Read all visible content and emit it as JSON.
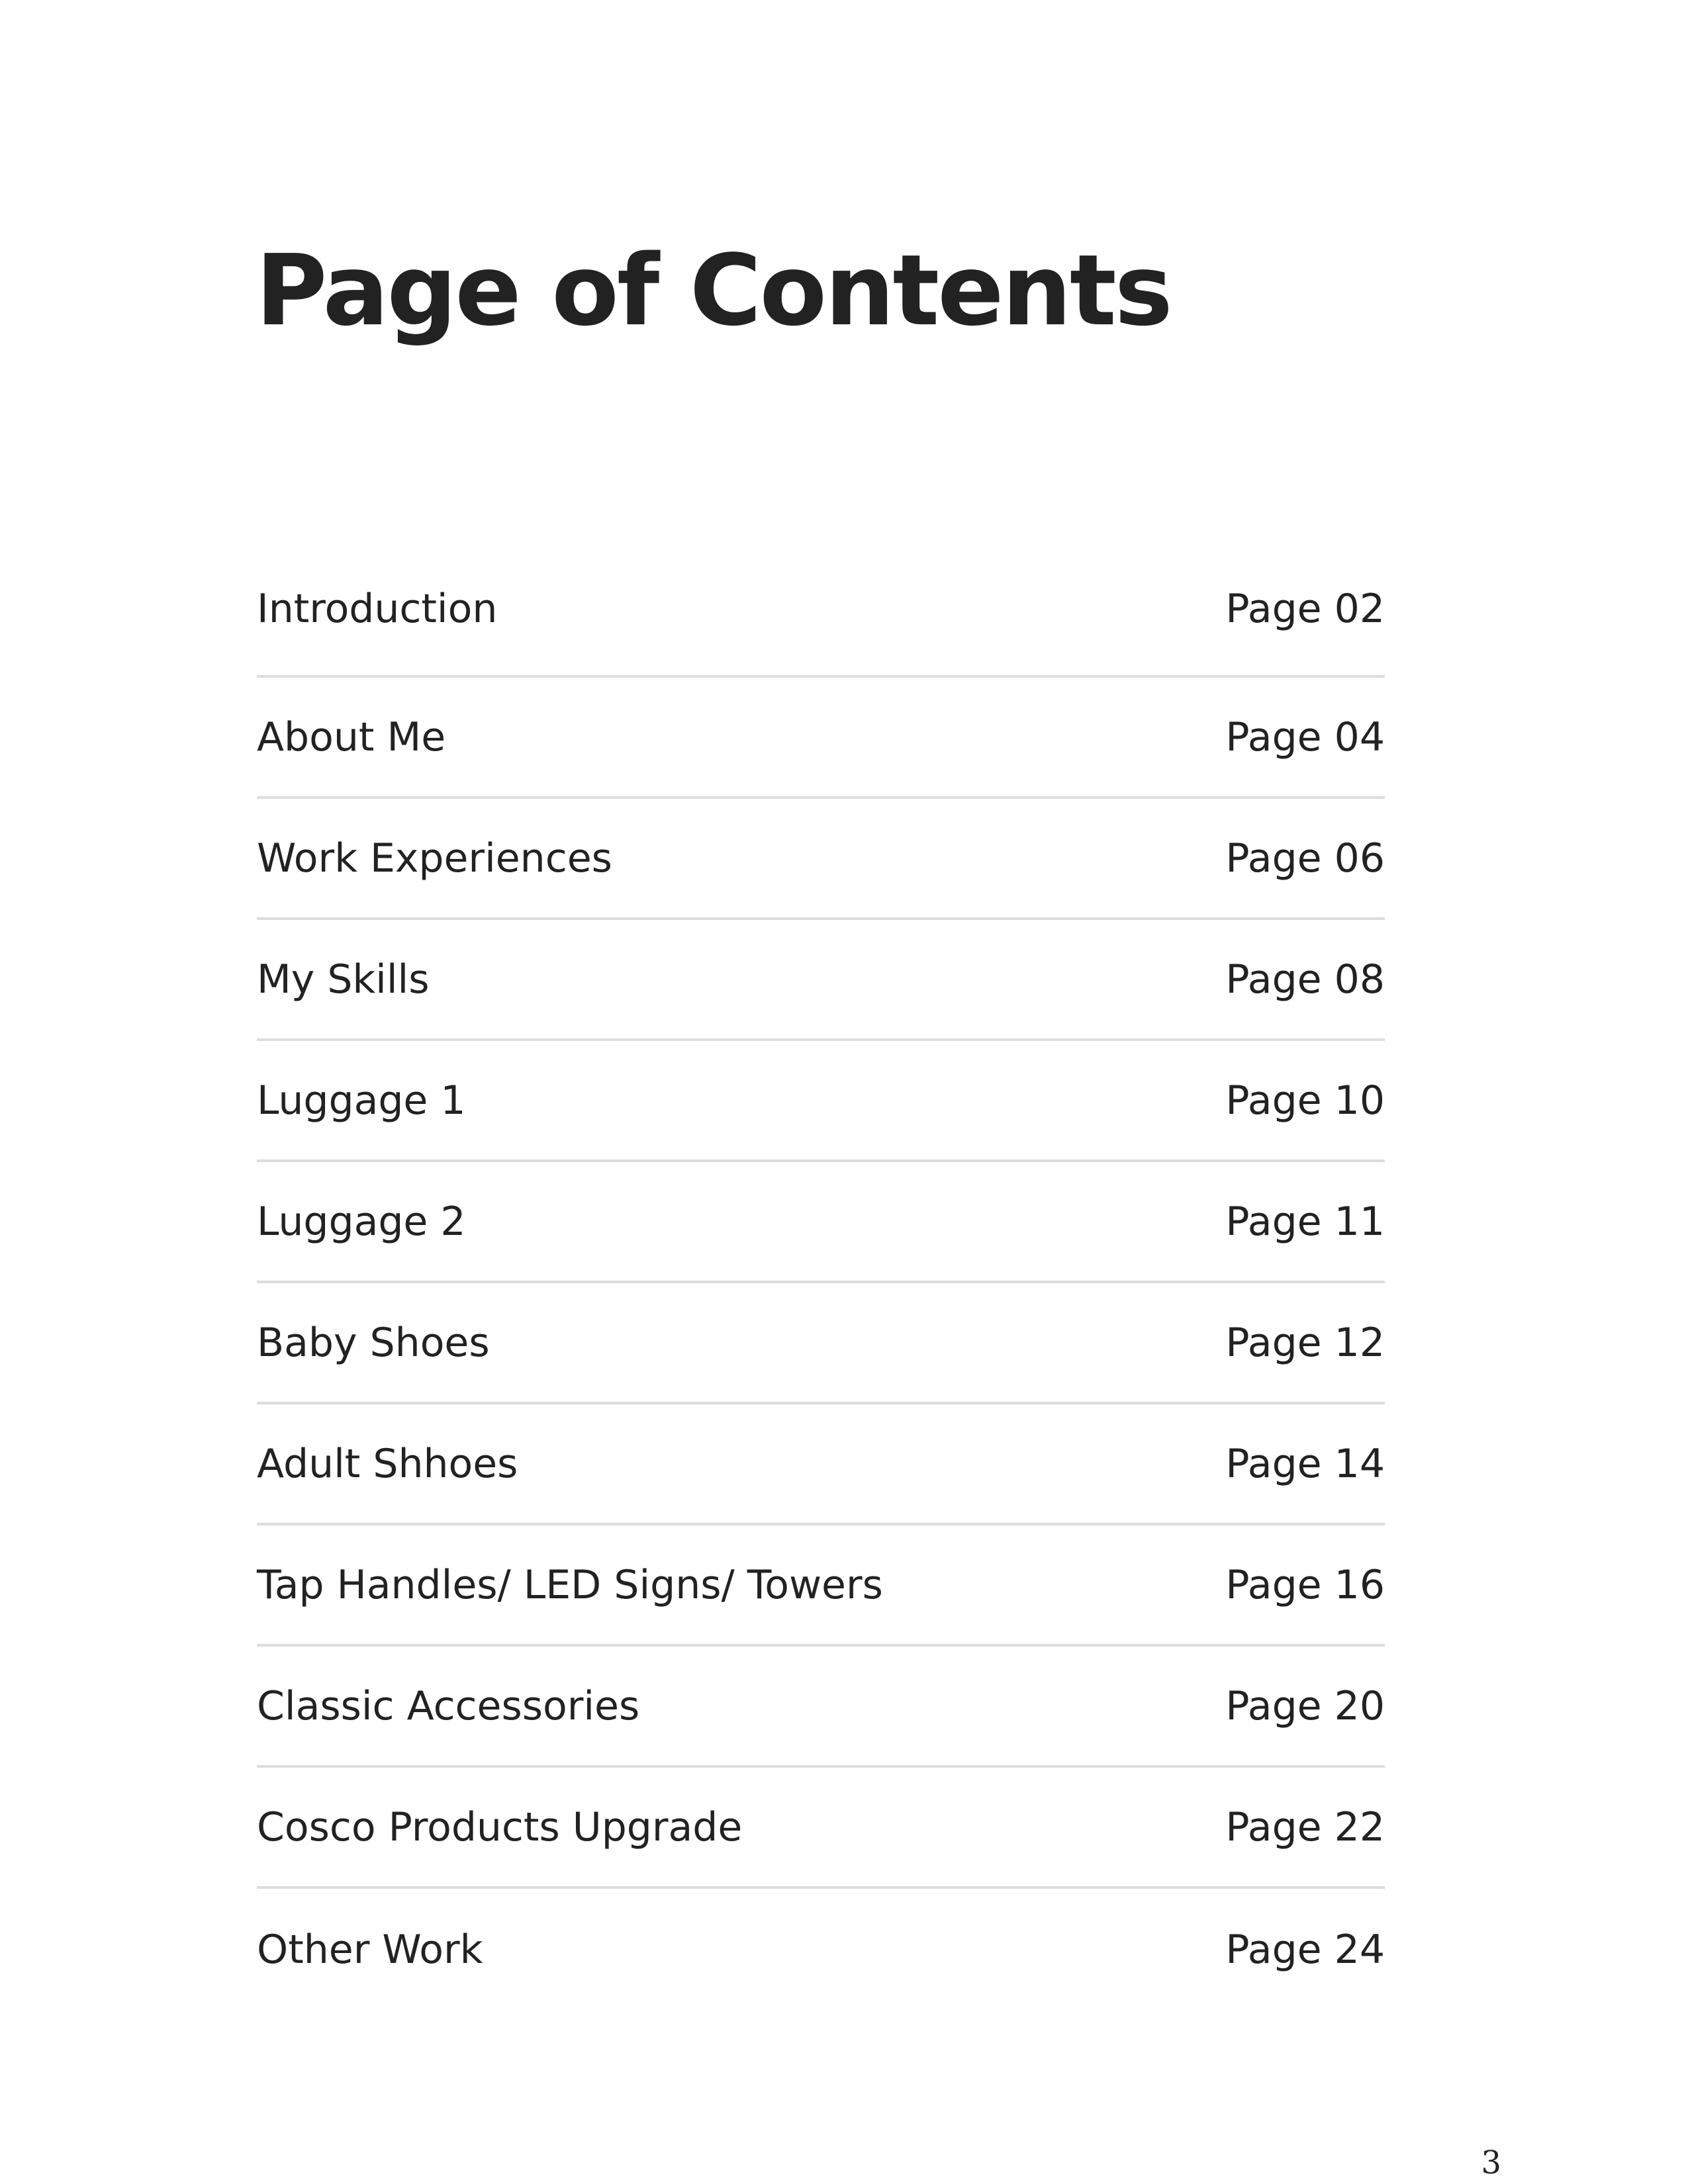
{
  "page": {
    "title": "Page of Contents",
    "page_number": "3"
  },
  "toc": {
    "entries": [
      {
        "title": "Introduction",
        "page": "Page 02"
      },
      {
        "title": "About Me",
        "page": "Page 04"
      },
      {
        "title": "Work Experiences",
        "page": "Page 06"
      },
      {
        "title": "My Skills",
        "page": "Page 08"
      },
      {
        "title": "Luggage 1",
        "page": "Page 10"
      },
      {
        "title": "Luggage 2",
        "page": "Page 11"
      },
      {
        "title": "Baby Shoes",
        "page": "Page 12"
      },
      {
        "title": "Adult Shhoes",
        "page": "Page 14"
      },
      {
        "title": "Tap Handles/ LED Signs/ Towers",
        "page": "Page 16"
      },
      {
        "title": "Classic Accessories",
        "page": "Page 20"
      },
      {
        "title": "Cosco Products Upgrade",
        "page": "Page 22"
      },
      {
        "title": "Other Work",
        "page": "Page 24"
      }
    ]
  }
}
